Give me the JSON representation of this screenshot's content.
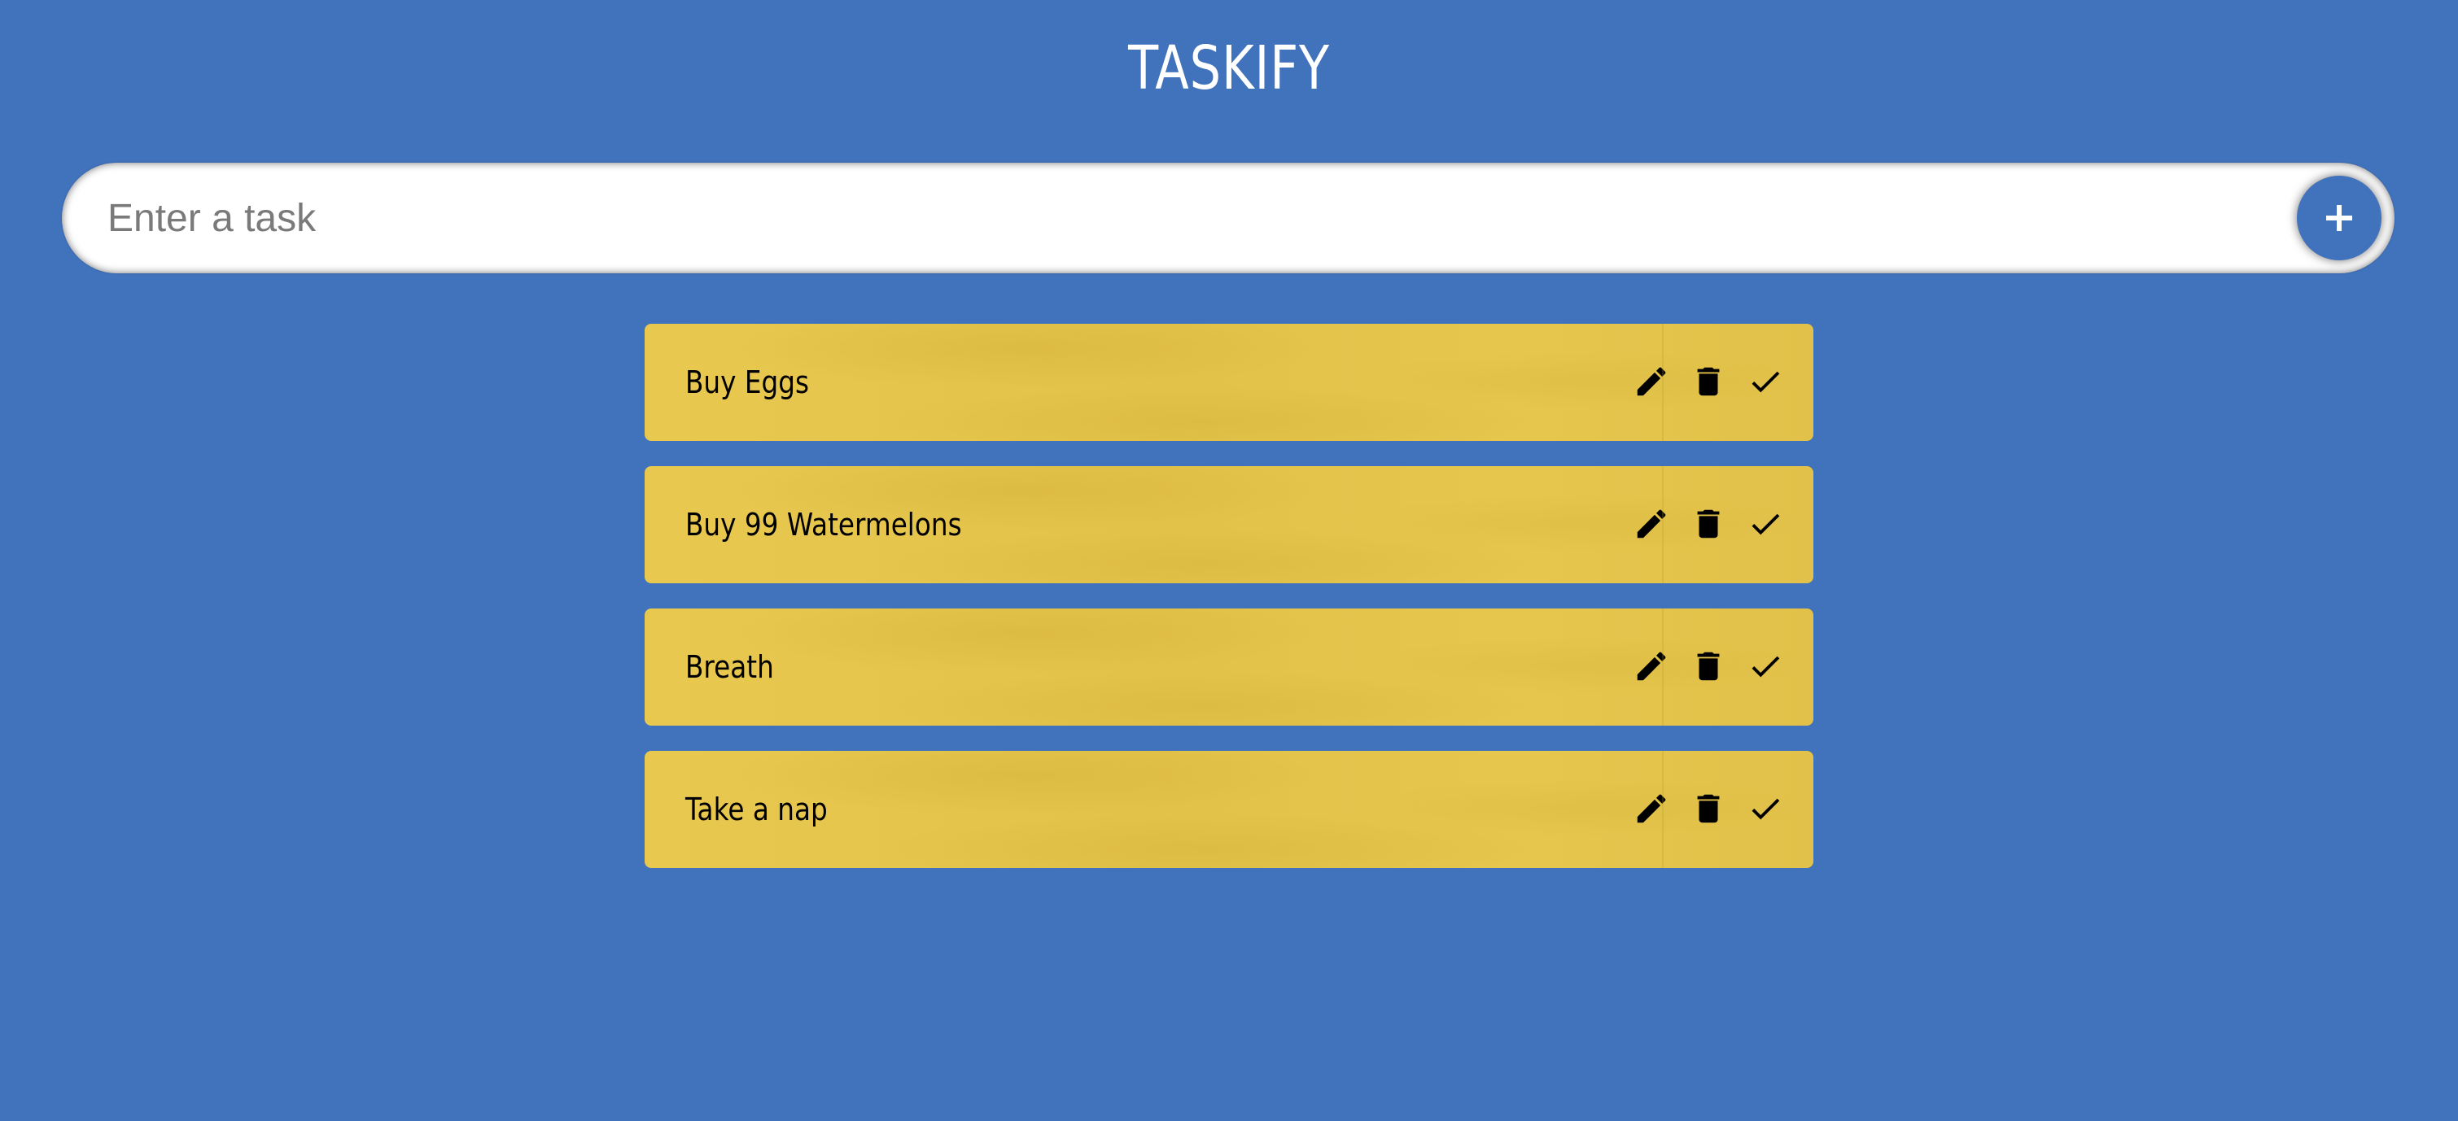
{
  "app": {
    "title": "TASKIFY"
  },
  "task_form": {
    "placeholder": "Enter a task",
    "value": "",
    "add_button_icon": "plus-icon"
  },
  "todos": [
    {
      "text": "Buy Eggs",
      "icons": [
        "pencil-icon",
        "trash-icon",
        "check-icon"
      ]
    },
    {
      "text": "Buy 99 Watermelons",
      "icons": [
        "pencil-icon",
        "trash-icon",
        "check-icon"
      ]
    },
    {
      "text": "Breath",
      "icons": [
        "pencil-icon",
        "trash-icon",
        "check-icon"
      ]
    },
    {
      "text": "Take a nap",
      "icons": [
        "pencil-icon",
        "trash-icon",
        "check-icon"
      ]
    }
  ],
  "colors": {
    "background": "#4172bc",
    "card": "#e6c64d",
    "input_background": "#ffffff",
    "title_text": "#ffffff",
    "card_text": "#000000"
  }
}
